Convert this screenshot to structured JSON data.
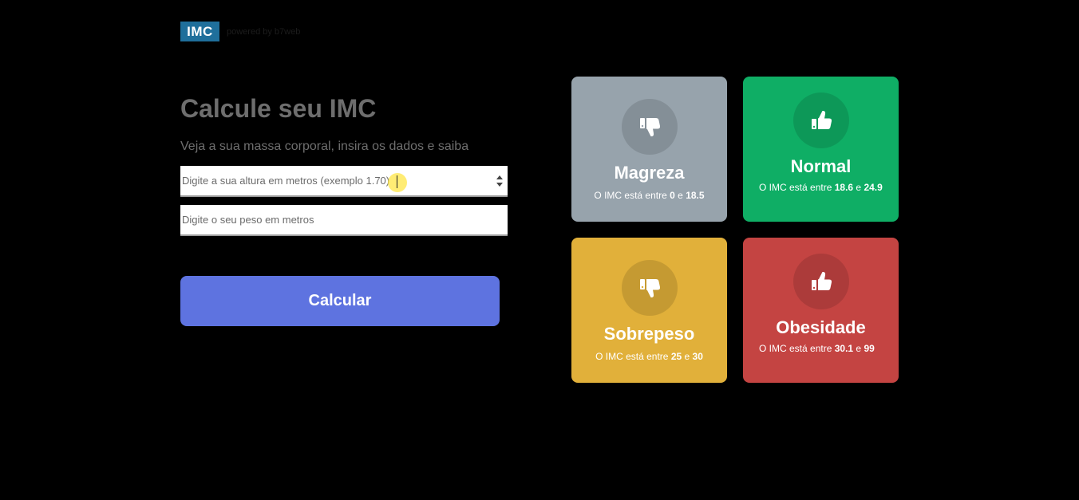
{
  "header": {
    "logo_text": "IMC",
    "powered_text": "powered by b7web"
  },
  "form": {
    "title": "Calcule seu IMC",
    "subtitle": "Veja a sua massa corporal, insira os dados e saiba",
    "height_placeholder": "Digite a sua altura em metros (exemplo 1.70)",
    "weight_placeholder": "Digite o seu peso em metros",
    "calculate_label": "Calcular"
  },
  "cards": [
    {
      "title": "Magreza",
      "range_prefix": "O IMC está entre",
      "min": "0",
      "joiner": "e",
      "max": "18.5",
      "icon": "thumbs-down-icon",
      "color": "#97a3ac"
    },
    {
      "title": "Normal",
      "range_prefix": "O IMC está entre",
      "min": "18.6",
      "joiner": "e",
      "max": "24.9",
      "icon": "thumbs-up-icon",
      "color": "#0fae65"
    },
    {
      "title": "Sobrepeso",
      "range_prefix": "O IMC está entre",
      "min": "25",
      "joiner": "e",
      "max": "30",
      "icon": "thumbs-down-icon",
      "color": "#e1b03a"
    },
    {
      "title": "Obesidade",
      "range_prefix": "O IMC está entre",
      "min": "30.1",
      "joiner": "e",
      "max": "99",
      "icon": "thumbs-up-icon",
      "color": "#c44442"
    }
  ]
}
